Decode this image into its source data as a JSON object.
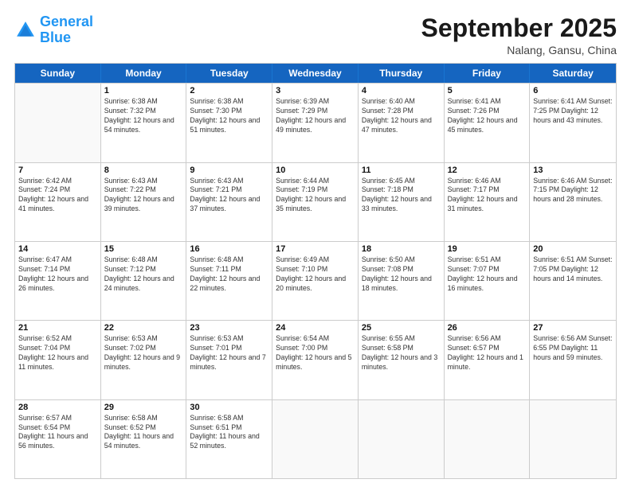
{
  "header": {
    "logo_line1": "General",
    "logo_line2": "Blue",
    "month": "September 2025",
    "location": "Nalang, Gansu, China"
  },
  "days_of_week": [
    "Sunday",
    "Monday",
    "Tuesday",
    "Wednesday",
    "Thursday",
    "Friday",
    "Saturday"
  ],
  "weeks": [
    [
      {
        "day": "",
        "info": ""
      },
      {
        "day": "1",
        "info": "Sunrise: 6:38 AM\nSunset: 7:32 PM\nDaylight: 12 hours\nand 54 minutes."
      },
      {
        "day": "2",
        "info": "Sunrise: 6:38 AM\nSunset: 7:30 PM\nDaylight: 12 hours\nand 51 minutes."
      },
      {
        "day": "3",
        "info": "Sunrise: 6:39 AM\nSunset: 7:29 PM\nDaylight: 12 hours\nand 49 minutes."
      },
      {
        "day": "4",
        "info": "Sunrise: 6:40 AM\nSunset: 7:28 PM\nDaylight: 12 hours\nand 47 minutes."
      },
      {
        "day": "5",
        "info": "Sunrise: 6:41 AM\nSunset: 7:26 PM\nDaylight: 12 hours\nand 45 minutes."
      },
      {
        "day": "6",
        "info": "Sunrise: 6:41 AM\nSunset: 7:25 PM\nDaylight: 12 hours\nand 43 minutes."
      }
    ],
    [
      {
        "day": "7",
        "info": "Sunrise: 6:42 AM\nSunset: 7:24 PM\nDaylight: 12 hours\nand 41 minutes."
      },
      {
        "day": "8",
        "info": "Sunrise: 6:43 AM\nSunset: 7:22 PM\nDaylight: 12 hours\nand 39 minutes."
      },
      {
        "day": "9",
        "info": "Sunrise: 6:43 AM\nSunset: 7:21 PM\nDaylight: 12 hours\nand 37 minutes."
      },
      {
        "day": "10",
        "info": "Sunrise: 6:44 AM\nSunset: 7:19 PM\nDaylight: 12 hours\nand 35 minutes."
      },
      {
        "day": "11",
        "info": "Sunrise: 6:45 AM\nSunset: 7:18 PM\nDaylight: 12 hours\nand 33 minutes."
      },
      {
        "day": "12",
        "info": "Sunrise: 6:46 AM\nSunset: 7:17 PM\nDaylight: 12 hours\nand 31 minutes."
      },
      {
        "day": "13",
        "info": "Sunrise: 6:46 AM\nSunset: 7:15 PM\nDaylight: 12 hours\nand 28 minutes."
      }
    ],
    [
      {
        "day": "14",
        "info": "Sunrise: 6:47 AM\nSunset: 7:14 PM\nDaylight: 12 hours\nand 26 minutes."
      },
      {
        "day": "15",
        "info": "Sunrise: 6:48 AM\nSunset: 7:12 PM\nDaylight: 12 hours\nand 24 minutes."
      },
      {
        "day": "16",
        "info": "Sunrise: 6:48 AM\nSunset: 7:11 PM\nDaylight: 12 hours\nand 22 minutes."
      },
      {
        "day": "17",
        "info": "Sunrise: 6:49 AM\nSunset: 7:10 PM\nDaylight: 12 hours\nand 20 minutes."
      },
      {
        "day": "18",
        "info": "Sunrise: 6:50 AM\nSunset: 7:08 PM\nDaylight: 12 hours\nand 18 minutes."
      },
      {
        "day": "19",
        "info": "Sunrise: 6:51 AM\nSunset: 7:07 PM\nDaylight: 12 hours\nand 16 minutes."
      },
      {
        "day": "20",
        "info": "Sunrise: 6:51 AM\nSunset: 7:05 PM\nDaylight: 12 hours\nand 14 minutes."
      }
    ],
    [
      {
        "day": "21",
        "info": "Sunrise: 6:52 AM\nSunset: 7:04 PM\nDaylight: 12 hours\nand 11 minutes."
      },
      {
        "day": "22",
        "info": "Sunrise: 6:53 AM\nSunset: 7:02 PM\nDaylight: 12 hours\nand 9 minutes."
      },
      {
        "day": "23",
        "info": "Sunrise: 6:53 AM\nSunset: 7:01 PM\nDaylight: 12 hours\nand 7 minutes."
      },
      {
        "day": "24",
        "info": "Sunrise: 6:54 AM\nSunset: 7:00 PM\nDaylight: 12 hours\nand 5 minutes."
      },
      {
        "day": "25",
        "info": "Sunrise: 6:55 AM\nSunset: 6:58 PM\nDaylight: 12 hours\nand 3 minutes."
      },
      {
        "day": "26",
        "info": "Sunrise: 6:56 AM\nSunset: 6:57 PM\nDaylight: 12 hours\nand 1 minute."
      },
      {
        "day": "27",
        "info": "Sunrise: 6:56 AM\nSunset: 6:55 PM\nDaylight: 11 hours\nand 59 minutes."
      }
    ],
    [
      {
        "day": "28",
        "info": "Sunrise: 6:57 AM\nSunset: 6:54 PM\nDaylight: 11 hours\nand 56 minutes."
      },
      {
        "day": "29",
        "info": "Sunrise: 6:58 AM\nSunset: 6:52 PM\nDaylight: 11 hours\nand 54 minutes."
      },
      {
        "day": "30",
        "info": "Sunrise: 6:58 AM\nSunset: 6:51 PM\nDaylight: 11 hours\nand 52 minutes."
      },
      {
        "day": "",
        "info": ""
      },
      {
        "day": "",
        "info": ""
      },
      {
        "day": "",
        "info": ""
      },
      {
        "day": "",
        "info": ""
      }
    ]
  ]
}
